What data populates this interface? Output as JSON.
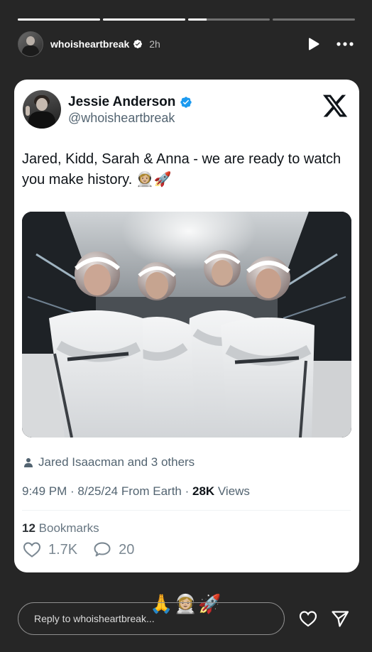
{
  "story": {
    "segments": [
      {
        "progress": 1.0
      },
      {
        "progress": 1.0
      },
      {
        "progress": 0.23
      },
      {
        "progress": 0.0
      }
    ],
    "username": "whoisheartbreak",
    "time_ago": "2h"
  },
  "tweet": {
    "display_name": "Jessie Anderson",
    "handle": "@whoisheartbreak",
    "text": "Jared, Kidd, Sarah & Anna - we are ready to watch you make history. 👩🏼‍🚀🚀",
    "tagged": "Jared Isaacman and 3 others",
    "time": "9:49 PM · 8/25/24 From Earth · ",
    "views_count": "28K",
    "views_label": " Views",
    "bookmarks_count": "12",
    "bookmarks_label": " Bookmarks",
    "likes": "1.7K",
    "replies": "20"
  },
  "reactions": [
    "🙏",
    "👩🏼‍🚀",
    "🚀"
  ],
  "reply": {
    "placeholder": "Reply to whoisheartbreak..."
  },
  "colors": {
    "background": "#262626",
    "verified": "#1d9bf0",
    "card": "#ffffff",
    "secondary_text": "#536471"
  }
}
